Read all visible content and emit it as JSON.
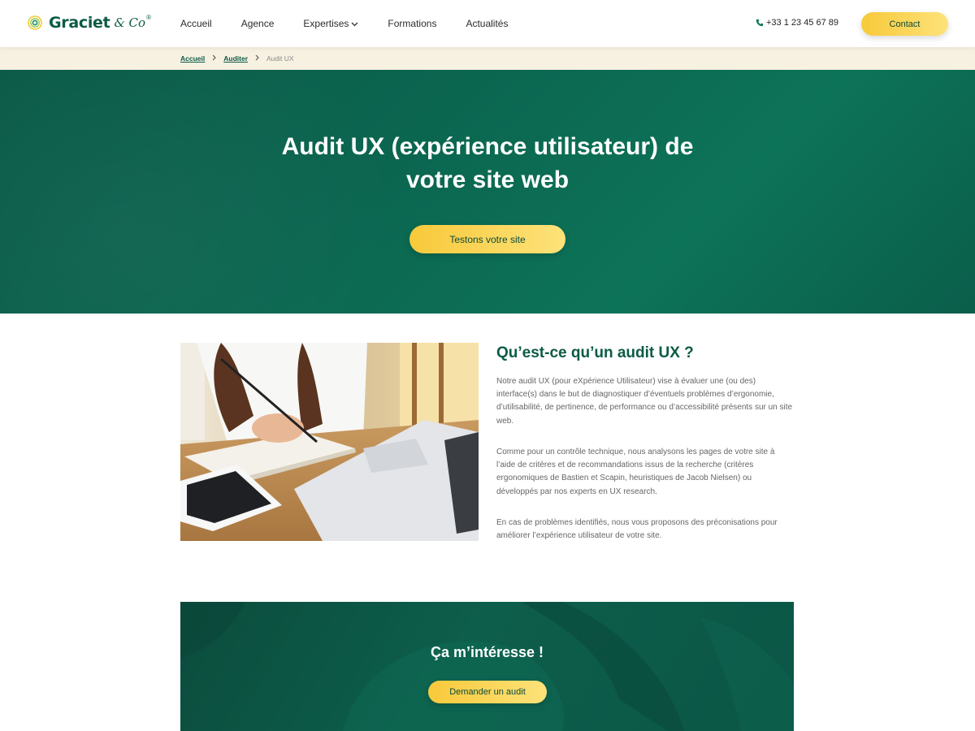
{
  "brand": {
    "name": "Graciet",
    "suffix": "& Co",
    "reg": "®"
  },
  "nav": {
    "items": [
      {
        "label": "Accueil"
      },
      {
        "label": "Agence"
      },
      {
        "label": "Expertises"
      },
      {
        "label": "Formations"
      },
      {
        "label": "Actualités"
      }
    ],
    "phone": "+33 1 23 45 67 89",
    "contact_label": "Contact"
  },
  "breadcrumb": {
    "items": [
      {
        "label": "Accueil"
      },
      {
        "label": "Auditer"
      }
    ],
    "current": "Audit UX"
  },
  "hero": {
    "title_line1": "Audit UX (expérience utilisateur) de",
    "title_line2": "votre site web",
    "button_label": "Testons votre site"
  },
  "intro": {
    "title": "Qu’est-ce qu’un audit UX ?",
    "paragraphs": [
      "Notre audit UX (pour eXpérience Utilisateur) vise à évaluer une (ou des) interface(s) dans le but de diagnostiquer d’éventuels problèmes d’ergonomie, d’utilisabilité, de pertinence, de performance ou d’accessibilité présents sur un site web.",
      "Comme pour un contrôle technique, nous analysons les pages de votre site à l’aide de critères et de recommandations issus de la recherche (critères ergonomiques de Bastien et Scapin, heuristiques de Jacob Nielsen) ou développés par nos experts en UX research.",
      "En cas de problèmes identifiés, nous vous proposons des préconisations pour améliorer l’expérience utilisateur de votre site."
    ]
  },
  "cta": {
    "title": "Ça m’intéresse !",
    "button_label": "Demander un audit"
  },
  "colors": {
    "brand_green": "#0c5b45",
    "accent_yellow": "#f8c93a",
    "breadcrumb_bg": "#f7f1e1"
  }
}
